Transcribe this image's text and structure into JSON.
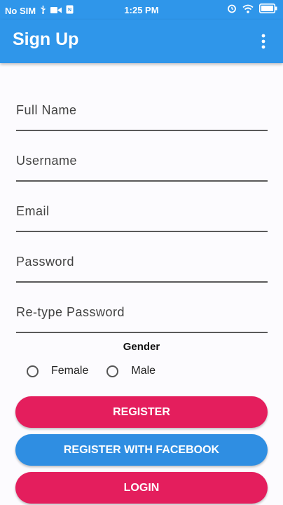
{
  "status_bar": {
    "carrier": "No SIM",
    "time": "1:25 PM"
  },
  "app_bar": {
    "title": "Sign Up"
  },
  "form": {
    "fields": [
      {
        "placeholder": "Full Name",
        "value": ""
      },
      {
        "placeholder": "Username",
        "value": ""
      },
      {
        "placeholder": "Email",
        "value": ""
      },
      {
        "placeholder": "Password",
        "value": ""
      },
      {
        "placeholder": "Re-type Password",
        "value": ""
      }
    ],
    "gender": {
      "label": "Gender",
      "options": [
        "Female",
        "Male"
      ]
    }
  },
  "buttons": {
    "register": "REGISTER",
    "facebook": "REGISTER WITH FACEBOOK",
    "login": "LOGIN"
  },
  "colors": {
    "primary": "#2f96ea",
    "accent": "#e41e5d",
    "facebook": "#2f8ee2"
  }
}
